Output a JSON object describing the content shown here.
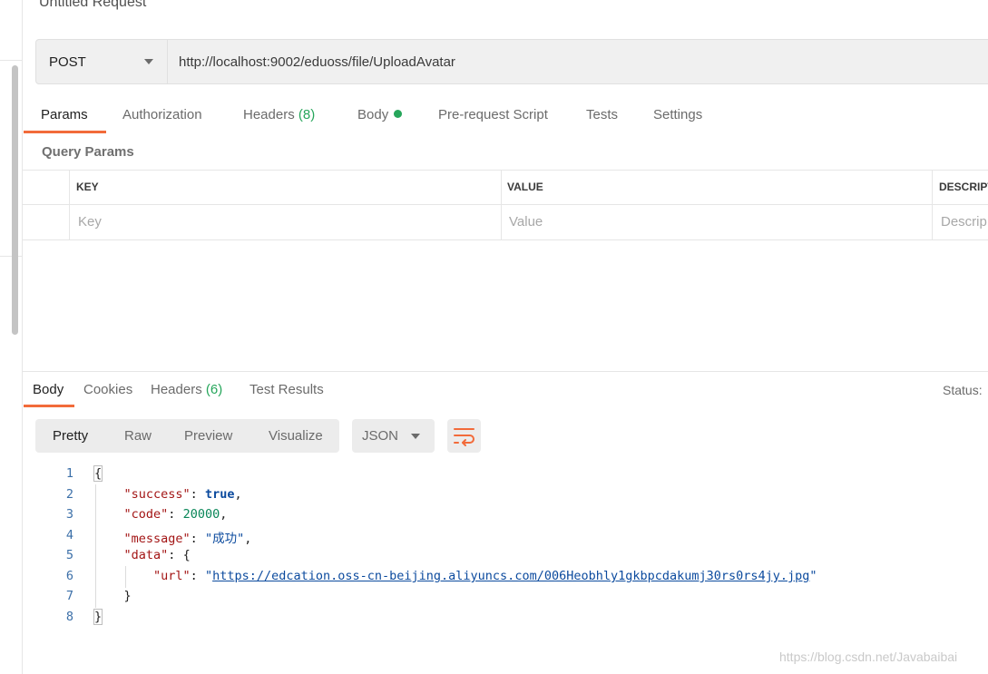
{
  "request": {
    "title": "Untitled Request",
    "method": "POST",
    "url": "http://localhost:9002/eduoss/file/UploadAvatar",
    "tabs": [
      {
        "label": "Params"
      },
      {
        "label": "Authorization"
      },
      {
        "label": "Headers",
        "count": "(8)"
      },
      {
        "label": "Body"
      },
      {
        "label": "Pre-request Script"
      },
      {
        "label": "Tests"
      },
      {
        "label": "Settings"
      }
    ],
    "active_tab": "Params",
    "body_indicator_color": "#26a65b"
  },
  "params": {
    "section_label": "Query Params",
    "columns": [
      "KEY",
      "VALUE",
      "DESCRIPT"
    ],
    "placeholders": {
      "key": "Key",
      "value": "Value",
      "description": "Descrip"
    }
  },
  "response": {
    "tabs": [
      {
        "label": "Body"
      },
      {
        "label": "Cookies"
      },
      {
        "label": "Headers",
        "count": "(6)"
      },
      {
        "label": "Test Results"
      }
    ],
    "active_tab": "Body",
    "status_label": "Status:",
    "view_modes": [
      "Pretty",
      "Raw",
      "Preview",
      "Visualize"
    ],
    "active_view": "Pretty",
    "format": "JSON",
    "wrap_icon": "wrap-lines-icon",
    "line_numbers": [
      "1",
      "2",
      "3",
      "4",
      "5",
      "6",
      "7",
      "8"
    ],
    "json": {
      "open": "{",
      "success_key": "\"success\"",
      "success_val": "true",
      "code_key": "\"code\"",
      "code_val": "20000",
      "message_key": "\"message\"",
      "message_val": "\"成功\"",
      "data_key": "\"data\"",
      "data_open": "{",
      "url_key": "\"url\"",
      "url_val": "https://edcation.oss-cn-beijing.aliyuncs.com/006Heobhly1gkbpcdakumj30rs0rs4jy.jpg",
      "data_close": "}",
      "close": "}"
    }
  },
  "watermark": "https://blog.csdn.net/Javabaibai",
  "colors": {
    "accent": "#f26b3a",
    "count_green": "#26a65b"
  }
}
